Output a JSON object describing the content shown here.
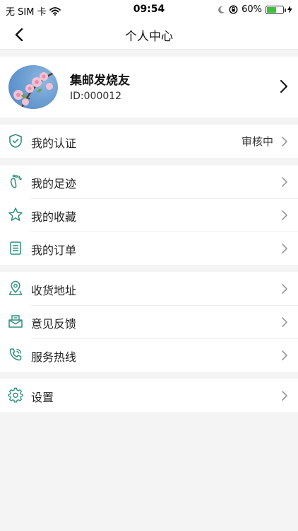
{
  "status_bar": {
    "carrier": "无 SIM 卡",
    "time": "09:54",
    "battery_percent": "60%",
    "battery_level": 0.6,
    "icons": [
      "wifi-icon",
      "moon-icon",
      "orientation-lock-icon",
      "battery-icon"
    ]
  },
  "nav": {
    "title": "个人中心",
    "back_icon": "back-arrow-icon"
  },
  "profile": {
    "name": "集邮发烧友",
    "id_text": "ID:000012",
    "avatar": "peach-blossom-photo"
  },
  "certification": {
    "label": "我的认证",
    "status": "审核中",
    "icon": "shield-check-icon"
  },
  "activity_group": [
    {
      "label": "我的足迹",
      "icon": "footprint-icon"
    },
    {
      "label": "我的收藏",
      "icon": "star-icon"
    },
    {
      "label": "我的订单",
      "icon": "order-list-icon"
    }
  ],
  "service_group": [
    {
      "label": "收货地址",
      "icon": "location-icon"
    },
    {
      "label": "意见反馈",
      "icon": "mail-feedback-icon"
    },
    {
      "label": "服务热线",
      "icon": "phone-call-icon"
    }
  ],
  "settings": {
    "label": "设置",
    "icon": "gear-icon"
  },
  "colors": {
    "accent": "#2f8f7d",
    "background": "#f4f4f4",
    "battery_fill": "#3cc13b",
    "chevron": "#9a9a9a"
  }
}
